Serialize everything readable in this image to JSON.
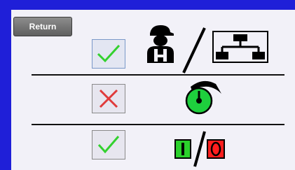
{
  "buttons": {
    "return_label": "Return"
  },
  "rows": [
    {
      "status": "ok",
      "icons": [
        "operator-icon",
        "slash-divider-icon",
        "network-icon"
      ]
    },
    {
      "status": "error",
      "icons": [
        "gauge-icon"
      ]
    },
    {
      "status": "ok",
      "icons": [
        "on-off-switch-icon"
      ]
    }
  ],
  "colors": {
    "frame_blue": "#1f1fd8",
    "check_green": "#33d12f",
    "cross_red": "#e03a3a",
    "gauge_green": "#1ecf3d"
  }
}
